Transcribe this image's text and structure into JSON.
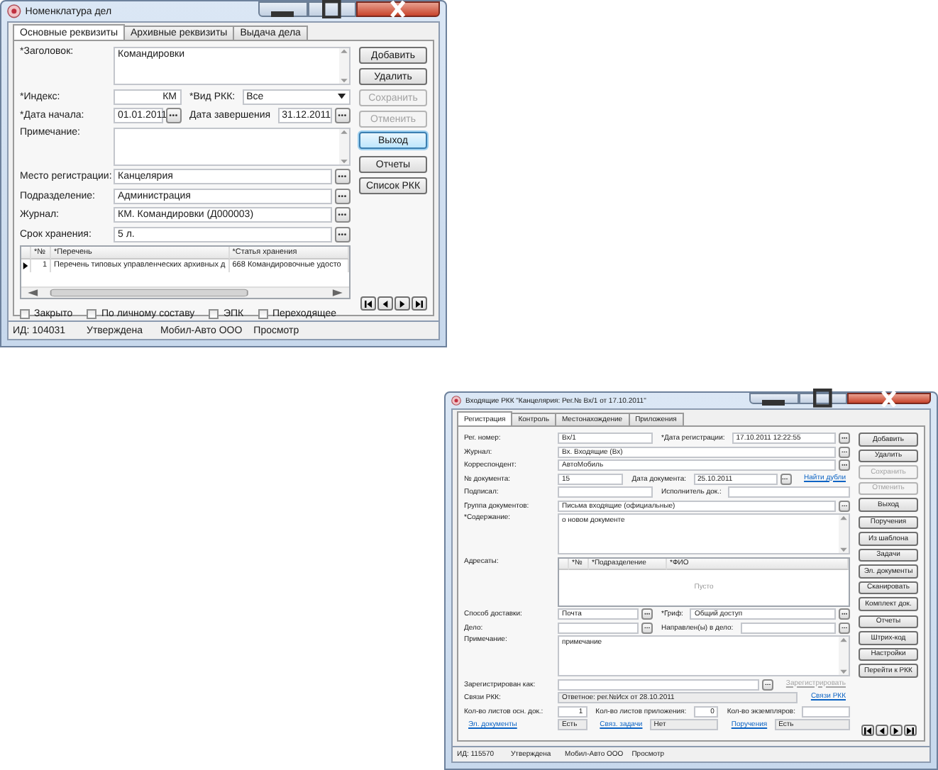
{
  "windows": [
    {
      "title": "Номенклатура дел",
      "tabs": [
        {
          "label": "Основные реквизиты",
          "selected": true
        },
        {
          "label": "Архивные реквизиты",
          "selected": false
        },
        {
          "label": "Выдача дела",
          "selected": false
        }
      ],
      "form": [
        {
          "items": [
            {
              "kind": "memo",
              "label": "*Заголовок:",
              "value": "Командировки"
            }
          ]
        },
        {
          "items": [
            {
              "kind": "right",
              "label": "*Индекс:",
              "value": "КМ"
            },
            {
              "kind": "select",
              "label": "*Вид РКК:",
              "value": "Все"
            }
          ]
        },
        {
          "items": [
            {
              "kind": "picker",
              "label": "*Дата начала:",
              "value": "01.01.2011"
            },
            {
              "kind": "picker",
              "label": "Дата завершения",
              "value": "31.12.2011"
            }
          ]
        },
        {
          "items": [
            {
              "kind": "memo",
              "label": "Примечание:"
            }
          ]
        },
        {
          "items": [
            {
              "kind": "picker",
              "label": "Место регистрации:",
              "value": "Канцелярия"
            }
          ]
        },
        {
          "items": [
            {
              "kind": "picker",
              "label": "Подразделение:",
              "value": "Администрация"
            }
          ]
        },
        {
          "items": [
            {
              "kind": "picker",
              "label": "Журнал:",
              "value": "КМ. Командировки (Д000003)"
            }
          ]
        },
        {
          "items": [
            {
              "kind": "picker",
              "label": "Срок хранения:",
              "value": "5 л."
            }
          ]
        },
        {
          "items": [
            {
              "kind": "grid",
              "columns": [
                "*№",
                "*Перечень",
                "*Статья хранения"
              ],
              "rows": [
                {
                  "selected": true,
                  "cells": [
                    "1",
                    "Перечень типовых управленческих архивных д",
                    "668 Командировочные удосто"
                  ]
                }
              ]
            }
          ]
        }
      ],
      "checkboxes": [
        {
          "label": "Закрыто",
          "checked": false
        },
        {
          "label": "По личному составу",
          "checked": false
        },
        {
          "label": "ЭПК",
          "checked": false
        },
        {
          "label": "Переходящее",
          "checked": false
        }
      ],
      "button_groups": [
        {
          "buttons": [
            {
              "label": "Добавить",
              "disabled": false,
              "default": false
            },
            {
              "label": "Удалить",
              "disabled": false,
              "default": false
            },
            {
              "label": "Сохранить",
              "disabled": true,
              "default": false
            },
            {
              "label": "Отменить",
              "disabled": true,
              "default": false
            },
            {
              "label": "Выход",
              "disabled": false,
              "default": true
            }
          ]
        },
        {
          "buttons": [
            {
              "label": "Отчеты",
              "disabled": false,
              "default": false
            },
            {
              "label": "Список РКК",
              "disabled": false,
              "default": false
            }
          ]
        }
      ],
      "status_bar": [
        "ИД: 104031",
        "Утверждена",
        "Мобил-Авто ООО",
        "Просмотр"
      ]
    },
    {
      "title": "Входящие РКК \"Канцелярия: Рег.№ Вх/1 от 17.10.2011\"",
      "tabs": [
        {
          "label": "Регистрация",
          "selected": true
        },
        {
          "label": "Контроль",
          "selected": false
        },
        {
          "label": "Местонахождение",
          "selected": false
        },
        {
          "label": "Приложения",
          "selected": false
        }
      ],
      "form": [
        {
          "items": [
            {
              "kind": "text",
              "label": "Рег. номер:",
              "value": "Вх/1"
            },
            {
              "kind": "picker",
              "label": "*Дата регистрации:",
              "value": "17.10.2011 12:22:55"
            }
          ]
        },
        {
          "items": [
            {
              "kind": "picker",
              "label": "Журнал:",
              "value": "Вх. Входящие (Вх)"
            }
          ]
        },
        {
          "items": [
            {
              "kind": "picker",
              "label": "Корреспондент:",
              "value": "АвтоМобиль"
            }
          ]
        },
        {
          "items": [
            {
              "kind": "text",
              "label": "№ документа:",
              "value": "15"
            },
            {
              "kind": "picker",
              "label": "Дата документа:",
              "value": "25.10.2011"
            },
            {
              "kind": "link",
              "text": "Найти дубли",
              "disabled": false
            }
          ]
        },
        {
          "items": [
            {
              "kind": "text",
              "label": "Подписал:"
            },
            {
              "kind": "text",
              "label": "Исполнитель док.:"
            }
          ]
        },
        {
          "items": [
            {
              "kind": "picker",
              "label": "Группа документов:",
              "value": "Письма входящие (официальные)"
            }
          ]
        },
        {
          "items": [
            {
              "kind": "memo",
              "label": "*Содержание:",
              "value": "о новом документе"
            }
          ]
        },
        {
          "items": [
            {
              "kind": "grid",
              "label": "Адресаты:",
              "columns": [
                "*№",
                "*Подразделение",
                "*ФИО"
              ],
              "empty_text": "Пусто"
            }
          ]
        },
        {
          "items": [
            {
              "kind": "picker",
              "label": "Способ доставки:",
              "value": "Почта"
            },
            {
              "kind": "picker",
              "label": "*Гриф:",
              "value": "Общий доступ"
            }
          ]
        },
        {
          "items": [
            {
              "kind": "picker",
              "label": "Дело:"
            },
            {
              "kind": "picker",
              "label": "Направлен(ы) в дело:"
            }
          ]
        },
        {
          "items": [
            {
              "kind": "memo",
              "label": "Примечание:",
              "value": "примечание"
            }
          ]
        },
        {
          "items": [
            {
              "kind": "picker",
              "label": "Зарегистрирован как:"
            },
            {
              "kind": "link",
              "text": "Зарегистрировать",
              "disabled": true
            }
          ]
        },
        {
          "items": [
            {
              "kind": "readonly",
              "label": "Связи РКК:",
              "value": "Ответное: рег.№Исх от 28.10.2011"
            },
            {
              "kind": "link",
              "text": "Связи РКК",
              "disabled": false
            }
          ]
        },
        {
          "items": [
            {
              "kind": "right",
              "label": "Кол-во листов осн. док.:",
              "value": "1"
            },
            {
              "kind": "right",
              "label": "Кол-во листов приложения:",
              "value": "0"
            },
            {
              "kind": "right",
              "label": "Кол-во экземпляров:"
            }
          ]
        },
        {
          "items": [
            {
              "kind": "link-field",
              "label": "Эл. документы",
              "value": "Есть"
            },
            {
              "kind": "link-field",
              "label": "Связ. задачи",
              "value": "Нет"
            },
            {
              "kind": "link-field",
              "label": "Поручения",
              "value": "Есть"
            }
          ]
        }
      ],
      "button_groups": [
        {
          "buttons": [
            {
              "label": "Добавить",
              "disabled": false,
              "default": false
            },
            {
              "label": "Удалить",
              "disabled": false,
              "default": false
            },
            {
              "label": "Сохранить",
              "disabled": true,
              "default": false
            },
            {
              "label": "Отменить",
              "disabled": true,
              "default": false
            },
            {
              "label": "Выход",
              "disabled": false,
              "default": false
            }
          ]
        },
        {
          "buttons": [
            {
              "label": "Поручения",
              "disabled": false,
              "default": false
            },
            {
              "label": "Из шаблона",
              "disabled": false,
              "default": false
            },
            {
              "label": "Задачи",
              "disabled": false,
              "default": false
            },
            {
              "label": "Эл. документы",
              "disabled": false,
              "default": false
            },
            {
              "label": "Сканировать",
              "disabled": false,
              "default": false
            },
            {
              "label": "Комплект док.",
              "disabled": false,
              "default": false
            }
          ]
        },
        {
          "buttons": [
            {
              "label": "Отчеты",
              "disabled": false,
              "default": false
            },
            {
              "label": "Штрих-код",
              "disabled": false,
              "default": false
            },
            {
              "label": "Настройки",
              "disabled": false,
              "default": false
            },
            {
              "label": "Перейти к РКК",
              "disabled": false,
              "default": false
            }
          ]
        }
      ],
      "status_bar": [
        "ИД: 115570",
        "Утверждена",
        "Мобил-Авто ООО",
        "Просмотр"
      ]
    }
  ]
}
